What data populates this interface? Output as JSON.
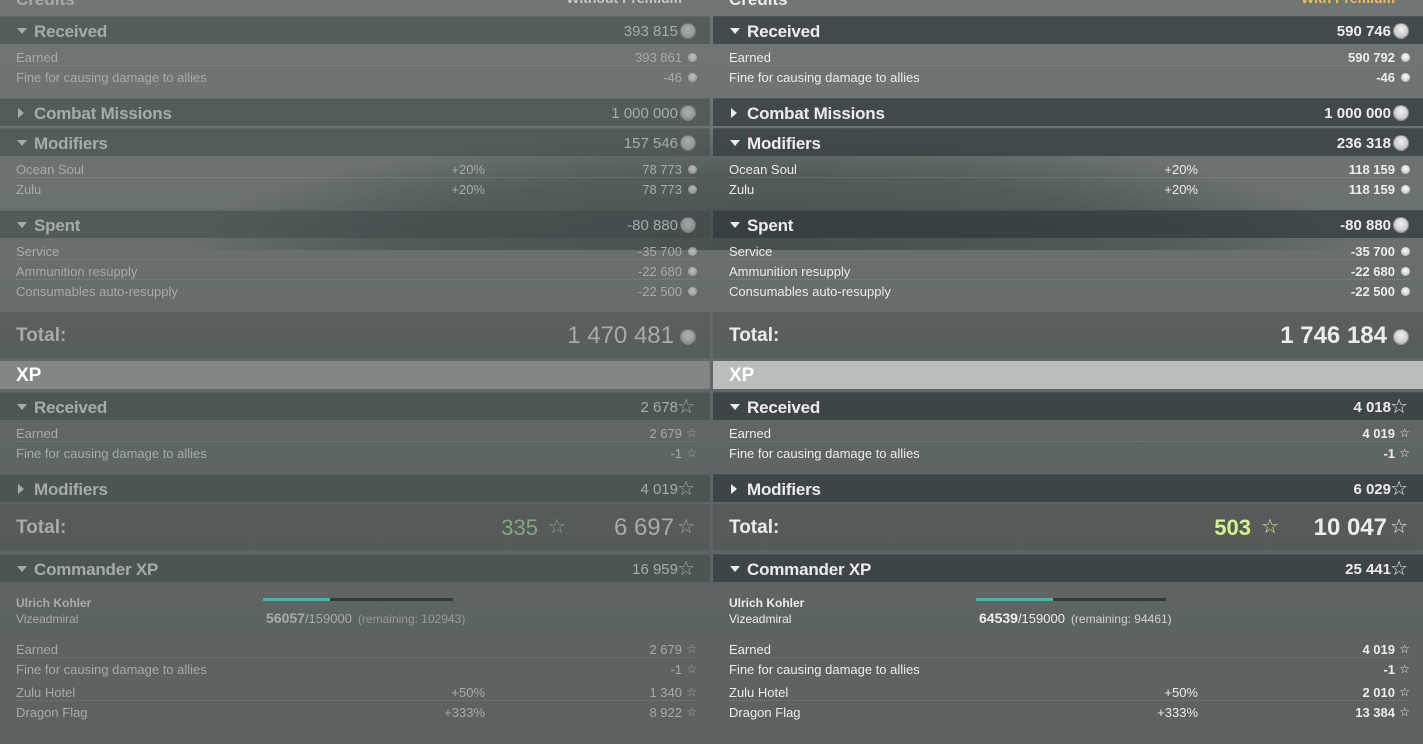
{
  "columns": [
    {
      "key": "left",
      "top_title": "Credits",
      "variant": "Without Premium",
      "variant_color": "#c8c8c8",
      "credits": {
        "received": {
          "label": "Received",
          "value": "393 815"
        },
        "received_items": [
          {
            "label": "Earned",
            "value": "393 861"
          },
          {
            "label": "Fine for causing damage to allies",
            "value": "-46"
          }
        ],
        "combat_missions": {
          "label": "Combat Missions",
          "value": "1 000 000"
        },
        "modifiers": {
          "label": "Modifiers",
          "value": "157 546"
        },
        "modifier_items": [
          {
            "label": "Ocean Soul",
            "pct": "+20%",
            "value": "78 773"
          },
          {
            "label": "Zulu",
            "pct": "+20%",
            "value": "78 773"
          }
        ],
        "spent": {
          "label": "Spent",
          "value": "-80 880"
        },
        "spent_items": [
          {
            "label": "Service",
            "value": "-35 700"
          },
          {
            "label": "Ammunition resupply",
            "value": "-22 680"
          },
          {
            "label": "Consumables auto-resupply",
            "value": "-22 500"
          }
        ],
        "total": {
          "label": "Total:",
          "value": "1 470 481"
        }
      },
      "xp": {
        "title": "XP",
        "received": {
          "label": "Received",
          "value": "2 678"
        },
        "received_items": [
          {
            "label": "Earned",
            "value": "2 679"
          },
          {
            "label": "Fine for causing damage to allies",
            "value": "-1"
          }
        ],
        "modifiers": {
          "label": "Modifiers",
          "value": "4 019"
        },
        "total": {
          "label": "Total:",
          "premium_value": "335",
          "value": "6 697"
        }
      },
      "commander": {
        "header": {
          "label": "Commander XP",
          "value": "16 959"
        },
        "name": "Ulrich Kohler",
        "rank": "Vizeadmiral",
        "progress_current": "56057",
        "progress_max": "/159000",
        "progress_remaining": "(remaining: 102943)",
        "progress_fraction": 0.3526,
        "items": [
          {
            "label": "Earned",
            "pct": "",
            "value": "2 679"
          },
          {
            "label": "Fine for causing damage to allies",
            "pct": "",
            "value": "-1"
          },
          {
            "label": "Zulu Hotel",
            "pct": "+50%",
            "value": "1 340"
          },
          {
            "label": "Dragon Flag",
            "pct": "+333%",
            "value": "8 922"
          }
        ]
      }
    },
    {
      "key": "right",
      "top_title": "Credits",
      "variant": "With Premium",
      "variant_color": "#e8c060",
      "credits": {
        "received": {
          "label": "Received",
          "value": "590 746"
        },
        "received_items": [
          {
            "label": "Earned",
            "value": "590 792"
          },
          {
            "label": "Fine for causing damage to allies",
            "value": "-46"
          }
        ],
        "combat_missions": {
          "label": "Combat Missions",
          "value": "1 000 000"
        },
        "modifiers": {
          "label": "Modifiers",
          "value": "236 318"
        },
        "modifier_items": [
          {
            "label": "Ocean Soul",
            "pct": "+20%",
            "value": "118 159"
          },
          {
            "label": "Zulu",
            "pct": "+20%",
            "value": "118 159"
          }
        ],
        "spent": {
          "label": "Spent",
          "value": "-80 880"
        },
        "spent_items": [
          {
            "label": "Service",
            "value": "-35 700"
          },
          {
            "label": "Ammunition resupply",
            "value": "-22 680"
          },
          {
            "label": "Consumables auto-resupply",
            "value": "-22 500"
          }
        ],
        "total": {
          "label": "Total:",
          "value": "1 746 184"
        }
      },
      "xp": {
        "title": "XP",
        "received": {
          "label": "Received",
          "value": "4 018"
        },
        "received_items": [
          {
            "label": "Earned",
            "value": "4 019"
          },
          {
            "label": "Fine for causing damage to allies",
            "value": "-1"
          }
        ],
        "modifiers": {
          "label": "Modifiers",
          "value": "6 029"
        },
        "total": {
          "label": "Total:",
          "premium_value": "503",
          "value": "10 047"
        }
      },
      "commander": {
        "header": {
          "label": "Commander XP",
          "value": "25 441"
        },
        "name": "Ulrich Kohler",
        "rank": "Vizeadmiral",
        "progress_current": "64539",
        "progress_max": "/159000",
        "progress_remaining": "(remaining: 94461)",
        "progress_fraction": 0.4059,
        "items": [
          {
            "label": "Earned",
            "pct": "",
            "value": "4 019"
          },
          {
            "label": "Fine for causing damage to allies",
            "pct": "",
            "value": "-1"
          },
          {
            "label": "Zulu Hotel",
            "pct": "+50%",
            "value": "2 010"
          },
          {
            "label": "Dragon Flag",
            "pct": "+333%",
            "value": "13 384"
          }
        ]
      }
    }
  ]
}
